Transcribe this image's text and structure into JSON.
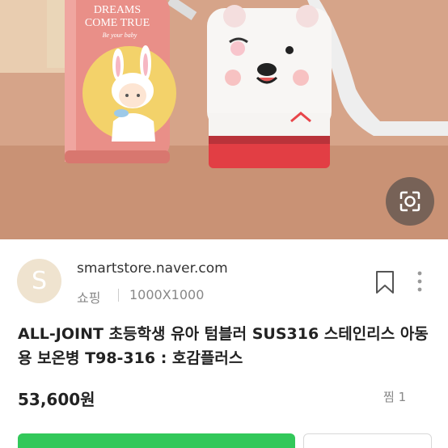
{
  "image": {
    "bottle_text_line1": "DREAMS",
    "bottle_text_line2": "COME TRUE",
    "bottle_signature": "Be your baby",
    "lens_button_icon": "lens-search-icon"
  },
  "source": {
    "avatar_letter": "S",
    "domain": "smartstore.naver.com",
    "category": "쇼핑",
    "image_size": "1000X1000",
    "bookmark_icon": "bookmark-icon",
    "more_icon": "more-vertical-icon"
  },
  "product": {
    "title": "ALL-JOINT 초등학생 유아 텀블러 SUS316 스테인리스 아동용 보온병 T98-316 : 호감플러스",
    "price": "53,600원",
    "wish_count": "찜 1"
  },
  "colors": {
    "accent_green": "#32c85a",
    "hero_bg": "#d4a084",
    "bottle_pink": "#e88a86"
  }
}
